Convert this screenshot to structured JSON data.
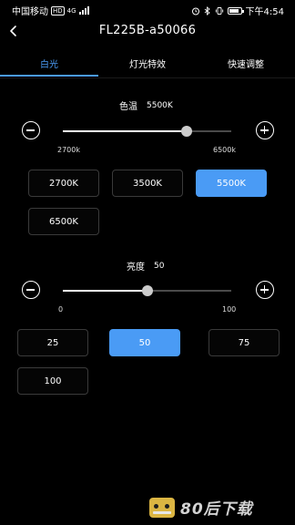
{
  "status_bar": {
    "carrier": "中国移动",
    "hd_badge": "HD",
    "network_label": "4G",
    "time": "下午4:54",
    "battery_level": 0.85
  },
  "header": {
    "title": "FL225B-a50066"
  },
  "tabs": [
    {
      "label": "白光",
      "active": true
    },
    {
      "label": "灯光特效",
      "active": false
    },
    {
      "label": "快速调整",
      "active": false
    }
  ],
  "color_temp": {
    "label": "色温",
    "value": "5500K",
    "min_label": "2700k",
    "max_label": "6500k",
    "min": 2700,
    "max": 6500,
    "current": 5500,
    "presets": [
      {
        "label": "2700K",
        "selected": false
      },
      {
        "label": "3500K",
        "selected": false
      },
      {
        "label": "5500K",
        "selected": true
      },
      {
        "label": "6500K",
        "selected": false
      }
    ]
  },
  "brightness": {
    "label": "亮度",
    "value": "50",
    "min_label": "0",
    "max_label": "100",
    "min": 0,
    "max": 100,
    "current": 50,
    "presets": [
      {
        "label": "25",
        "selected": false
      },
      {
        "label": "50",
        "selected": true
      },
      {
        "label": "75",
        "selected": false
      },
      {
        "label": "100",
        "selected": false
      }
    ]
  },
  "watermark": {
    "text": "80后下载"
  },
  "colors": {
    "accent": "#4a9bf5",
    "background": "#000000"
  }
}
